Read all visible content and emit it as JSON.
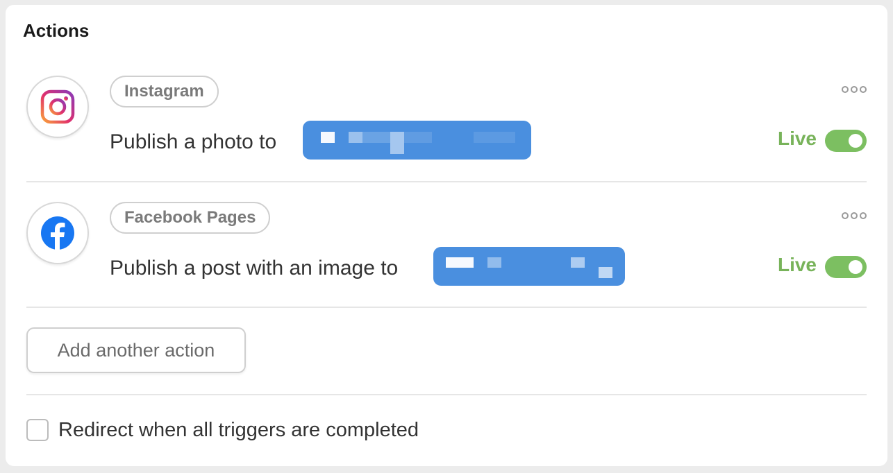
{
  "section": {
    "title": "Actions"
  },
  "actions": [
    {
      "app_name": "Instagram",
      "app_icon": "instagram-icon",
      "action_text": "Publish a photo to",
      "status": "Live",
      "enabled": true
    },
    {
      "app_name": "Facebook Pages",
      "app_icon": "facebook-icon",
      "action_text": "Publish a post with an image to",
      "status": "Live",
      "enabled": true
    }
  ],
  "add_action_label": "Add another action",
  "redirect": {
    "label": "Redirect when all triggers are completed",
    "checked": false
  },
  "colors": {
    "live": "#78b35a",
    "toggle_on": "#7cbf61",
    "target_pill": "#4a8fdf",
    "facebook": "#1877f2"
  },
  "icons": {
    "more": "more-icon"
  }
}
